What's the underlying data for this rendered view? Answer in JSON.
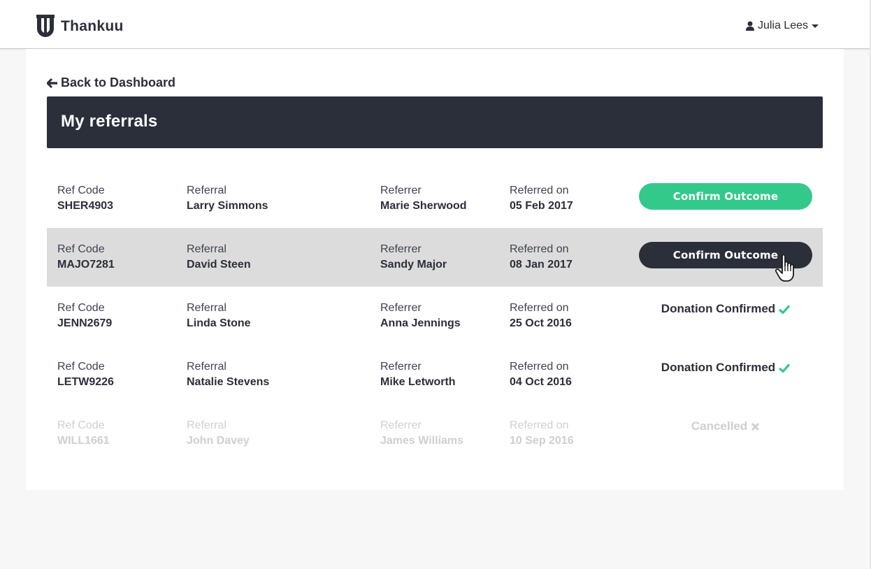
{
  "brand": {
    "name": "Thankuu"
  },
  "user": {
    "name": "Julia Lees"
  },
  "nav": {
    "back_label": "Back to Dashboard"
  },
  "page": {
    "title": "My referrals"
  },
  "colors": {
    "dark": "#2b2f3a",
    "accent_green": "#33c98a",
    "highlight_row": "#dcdcdc"
  },
  "labels": {
    "ref_code": "Ref Code",
    "referral": "Referral",
    "referrer": "Referrer",
    "referred_on": "Referred on"
  },
  "rows": [
    {
      "ref_code": "SHER4903",
      "referral": "Larry Simmons",
      "referrer": "Marie Sherwood",
      "referred_on": "05 Feb 2017",
      "action": "Confirm Outcome"
    },
    {
      "ref_code": "MAJO7281",
      "referral": "David Steen",
      "referrer": "Sandy Major",
      "referred_on": "08 Jan 2017",
      "action": "Confirm Outcome"
    },
    {
      "ref_code": "JENN2679",
      "referral": "Linda Stone",
      "referrer": "Anna Jennings",
      "referred_on": "25 Oct 2016",
      "status": "Donation Confirmed"
    },
    {
      "ref_code": "LETW9226",
      "referral": "Natalie Stevens",
      "referrer": "Mike Letworth",
      "referred_on": "04 Oct 2016",
      "status": "Donation Confirmed"
    },
    {
      "ref_code": "WILL1661",
      "referral": "John Davey",
      "referrer": "James Williams",
      "referred_on": "10 Sep 2016",
      "status": "Cancelled"
    }
  ]
}
